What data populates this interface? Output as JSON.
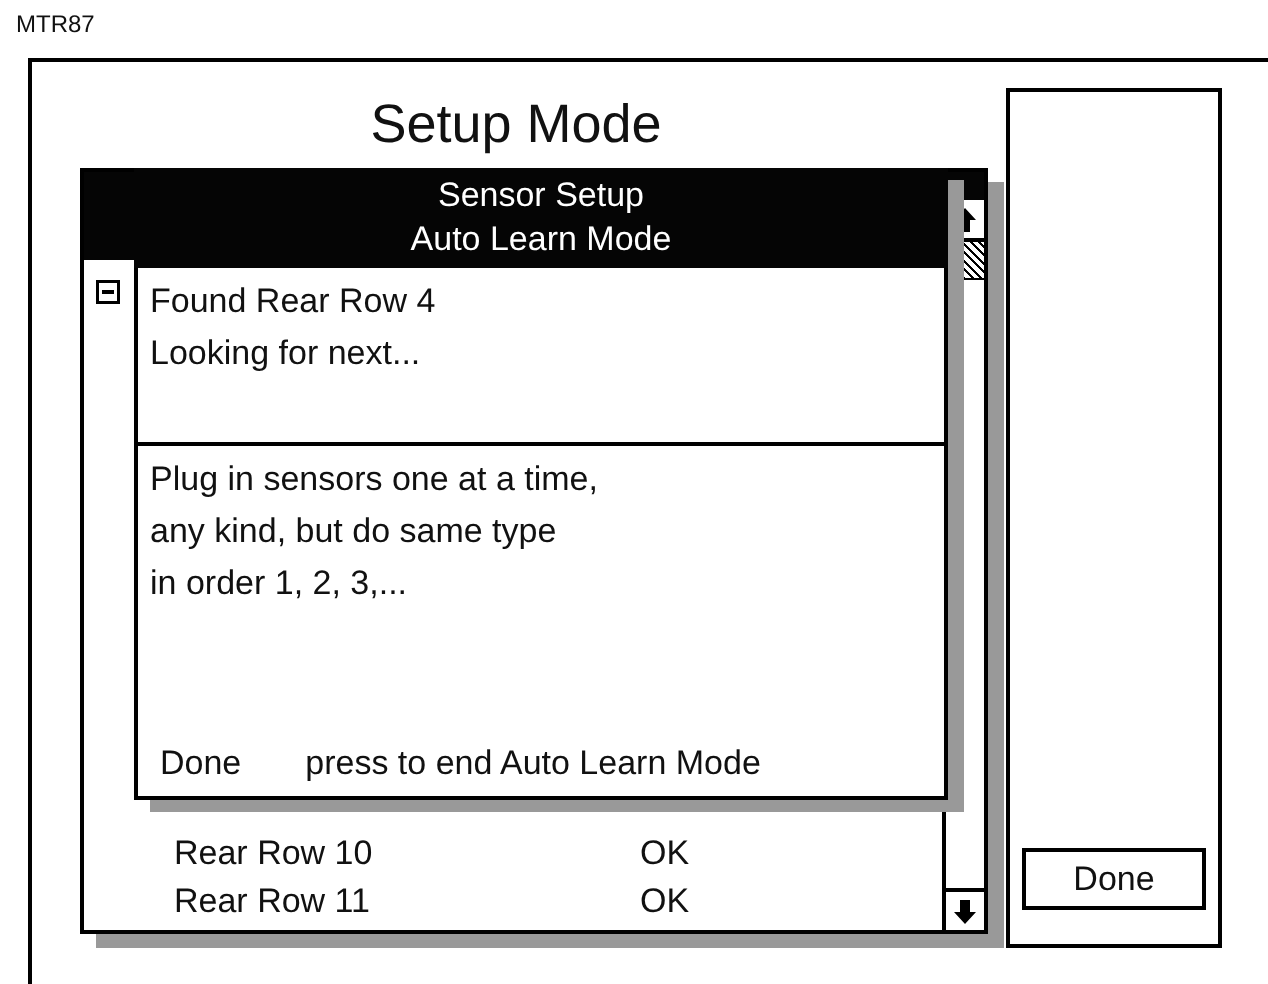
{
  "caption": "MTR87",
  "screen": {
    "title": "Setup Mode"
  },
  "list_window": {
    "rows": [
      {
        "name": "Rear Row 10",
        "status": "OK"
      },
      {
        "name": "Rear Row 11",
        "status": "OK"
      }
    ]
  },
  "dialog": {
    "title_lines": [
      "Sensor Setup",
      "Auto Learn Mode"
    ],
    "status_lines": [
      "Found Rear Row 4",
      "Looking for next..."
    ],
    "instruction_lines": [
      "Plug in sensors one at a time,",
      "any kind, but do same type",
      "in order 1, 2, 3,..."
    ],
    "footer": {
      "button": "Done",
      "hint": "press to end Auto Learn Mode"
    }
  },
  "side_panel": {
    "button": "Done"
  }
}
